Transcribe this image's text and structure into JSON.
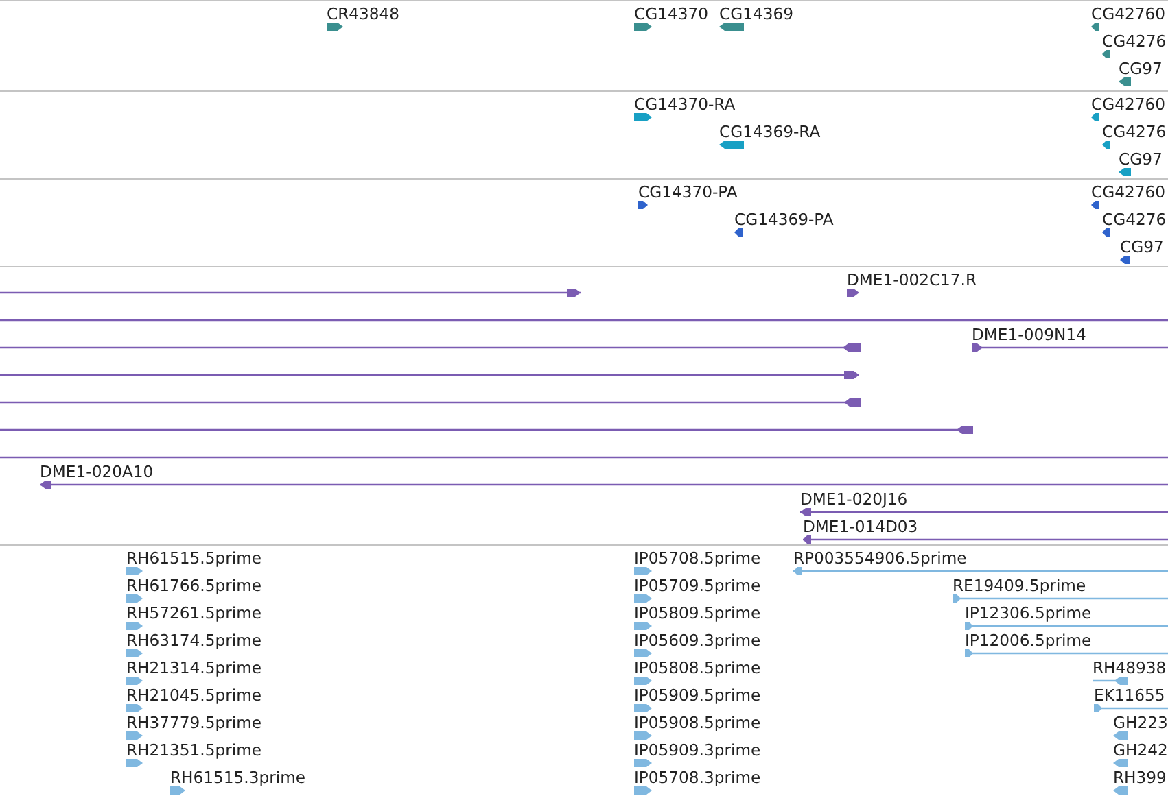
{
  "tracks": [
    {
      "color": "#3a8f8f",
      "features": [
        {
          "kind": "block",
          "label": "CR43848",
          "reverse": false
        },
        {
          "kind": "block",
          "label": "CG14370",
          "reverse": false
        },
        {
          "kind": "block",
          "label": "CG14369",
          "reverse": true
        },
        {
          "kind": "block",
          "label": "CG42760",
          "reverse": true
        },
        {
          "kind": "block",
          "label": "CG4276",
          "reverse": true
        },
        {
          "kind": "block",
          "label": "CG97",
          "reverse": true
        }
      ]
    },
    {
      "color": "#18a0c4",
      "features": [
        {
          "kind": "block",
          "label": "CG14370-RA",
          "reverse": false
        },
        {
          "kind": "block",
          "label": "CG14369-RA",
          "reverse": true
        },
        {
          "kind": "block",
          "label": "CG42760",
          "reverse": true
        },
        {
          "kind": "block",
          "label": "CG4276",
          "reverse": true
        },
        {
          "kind": "block",
          "label": "CG97",
          "reverse": true
        }
      ]
    },
    {
      "color": "#2f63cc",
      "features": [
        {
          "kind": "block",
          "label": "CG14370-PA",
          "reverse": false
        },
        {
          "kind": "block",
          "label": "CG14369-PA",
          "reverse": true
        },
        {
          "kind": "block",
          "label": "CG42760",
          "reverse": true
        },
        {
          "kind": "block",
          "label": "CG4276",
          "reverse": true
        },
        {
          "kind": "block",
          "label": "CG97",
          "reverse": true
        }
      ]
    },
    {
      "color": "#7b5cb2",
      "features": [
        {
          "kind": "line",
          "reverse": false
        },
        {
          "kind": "block",
          "label": "DME1-002C17.R",
          "reverse": false
        },
        {
          "kind": "line"
        },
        {
          "kind": "line",
          "reverse": true
        },
        {
          "kind": "line",
          "label": "DME1-009N14",
          "reverse": false
        },
        {
          "kind": "line",
          "reverse": false
        },
        {
          "kind": "line",
          "reverse": true
        },
        {
          "kind": "line",
          "reverse": true
        },
        {
          "kind": "line"
        },
        {
          "kind": "line",
          "label": "DME1-020A10",
          "reverse": true
        },
        {
          "kind": "line",
          "label": "DME1-020J16",
          "reverse": true
        },
        {
          "kind": "line",
          "label": "DME1-014D03",
          "reverse": true
        }
      ]
    },
    {
      "color": "#80b8e0",
      "features": [
        {
          "kind": "block",
          "label": "RH61515.5prime",
          "reverse": false
        },
        {
          "kind": "block",
          "label": "RH61766.5prime",
          "reverse": false
        },
        {
          "kind": "block",
          "label": "RH57261.5prime",
          "reverse": false
        },
        {
          "kind": "block",
          "label": "RH63174.5prime",
          "reverse": false
        },
        {
          "kind": "block",
          "label": "RH21314.5prime",
          "reverse": false
        },
        {
          "kind": "block",
          "label": "RH21045.5prime",
          "reverse": false
        },
        {
          "kind": "block",
          "label": "RH37779.5prime",
          "reverse": false
        },
        {
          "kind": "block",
          "label": "RH21351.5prime",
          "reverse": false
        },
        {
          "kind": "block",
          "label": "RH61515.3prime",
          "reverse": false
        },
        {
          "kind": "block",
          "label": "IP05708.5prime",
          "reverse": false
        },
        {
          "kind": "block",
          "label": "IP05709.5prime",
          "reverse": false
        },
        {
          "kind": "block",
          "label": "IP05809.5prime",
          "reverse": false
        },
        {
          "kind": "block",
          "label": "IP05609.3prime",
          "reverse": false
        },
        {
          "kind": "block",
          "label": "IP05808.5prime",
          "reverse": false
        },
        {
          "kind": "block",
          "label": "IP05909.5prime",
          "reverse": false
        },
        {
          "kind": "block",
          "label": "IP05908.5prime",
          "reverse": false
        },
        {
          "kind": "block",
          "label": "IP05909.3prime",
          "reverse": false
        },
        {
          "kind": "block",
          "label": "IP05708.3prime",
          "reverse": false
        },
        {
          "kind": "line",
          "label": "RP003554906.5prime",
          "reverse": true
        },
        {
          "kind": "line",
          "label": "RE19409.5prime",
          "reverse": false
        },
        {
          "kind": "line",
          "label": "IP12306.5prime",
          "reverse": false
        },
        {
          "kind": "line",
          "label": "IP12006.5prime",
          "reverse": false
        },
        {
          "kind": "line",
          "label": "RH48938",
          "reverse": true
        },
        {
          "kind": "line",
          "label": "EK11655",
          "reverse": false
        },
        {
          "kind": "block",
          "label": "GH223",
          "reverse": true
        },
        {
          "kind": "block",
          "label": "GH242",
          "reverse": true
        },
        {
          "kind": "block",
          "label": "RH399",
          "reverse": true
        }
      ]
    }
  ]
}
